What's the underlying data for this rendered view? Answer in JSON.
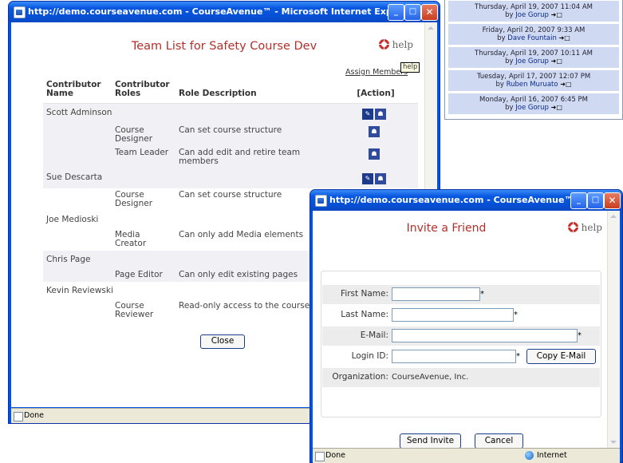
{
  "date_panel": {
    "items": [
      {
        "date": "Thursday, April 19, 2007 11:04 AM",
        "by": "by",
        "author": "Joe Gorup"
      },
      {
        "date": "Friday, April 20, 2007 9:33 AM",
        "by": "by",
        "author": "Dave Fountain"
      },
      {
        "date": "Thursday, April 19, 2007 10:11 AM",
        "by": "by",
        "author": "Joe Gorup"
      },
      {
        "date": "Tuesday, April 17, 2007 12:07 PM",
        "by": "by",
        "author": "Ruben Muruato"
      },
      {
        "date": "Monday, April 16, 2007 6:45 PM",
        "by": "by",
        "author": "Joe Gorup"
      }
    ]
  },
  "team_window": {
    "title": "http://demo.courseavenue.com - CourseAvenue™ - Microsoft Internet Explorer",
    "heading": "Team List for Safety Course Dev",
    "help_label": "help",
    "assign_members": "Assign Members",
    "tooltip": "help",
    "columns": [
      "Contributor Name",
      "Contributor Roles",
      "Role Description",
      "[Action]"
    ],
    "rows": [
      {
        "type": "person",
        "name": "Scott Adminson",
        "actions": [
          "edit",
          "person"
        ],
        "shade": true
      },
      {
        "type": "role",
        "role": "Course Designer",
        "desc": "Can set course structure",
        "actions": [
          "person"
        ],
        "shade": true
      },
      {
        "type": "role",
        "role": "Team Leader",
        "desc": "Can add edit and retire team members",
        "actions": [
          "person"
        ],
        "shade": true
      },
      {
        "type": "person",
        "name": "Sue Descarta",
        "actions": [
          "edit",
          "person"
        ],
        "shade": true
      },
      {
        "type": "role",
        "role": "Course Designer",
        "desc": "Can set course structure",
        "actions": [],
        "shade": false
      },
      {
        "type": "person",
        "name": "Joe Medioski",
        "actions": [],
        "shade": false
      },
      {
        "type": "role",
        "role": "Media Creator",
        "desc": "Can only add Media elements",
        "actions": [],
        "shade": false
      },
      {
        "type": "person",
        "name": "Chris Page",
        "actions": [],
        "shade": true
      },
      {
        "type": "role",
        "role": "Page Editor",
        "desc": "Can only edit existing pages",
        "actions": [],
        "shade": true
      },
      {
        "type": "person",
        "name": "Kevin Reviewski",
        "actions": [],
        "shade": false
      },
      {
        "type": "role",
        "role": "Course Reviewer",
        "desc": "Read-only access to the course",
        "actions": [],
        "shade": false
      }
    ],
    "close_label": "Close",
    "status": "Done"
  },
  "invite_window": {
    "title": "http://demo.courseavenue.com - CourseAvenue™ - Micr...",
    "heading": "Invite a Friend",
    "help_label": "help",
    "fields": {
      "first_name_label": "First Name:",
      "last_name_label": "Last Name:",
      "email_label": "E-Mail:",
      "login_label": "Login ID:",
      "org_label": "Organization:",
      "org_value": "CourseAvenue, Inc.",
      "required_mark": "*"
    },
    "copy_email_label": "Copy E-Mail",
    "send_label": "Send Invite",
    "cancel_label": "Cancel",
    "status": "Done",
    "zone": "Internet"
  },
  "icons": {
    "edit": "edit-icon",
    "person": "person-icon"
  },
  "colors": {
    "heading": "#b0302a",
    "titlebar": "#0054e3",
    "list_bg": "#cfdaf2"
  }
}
